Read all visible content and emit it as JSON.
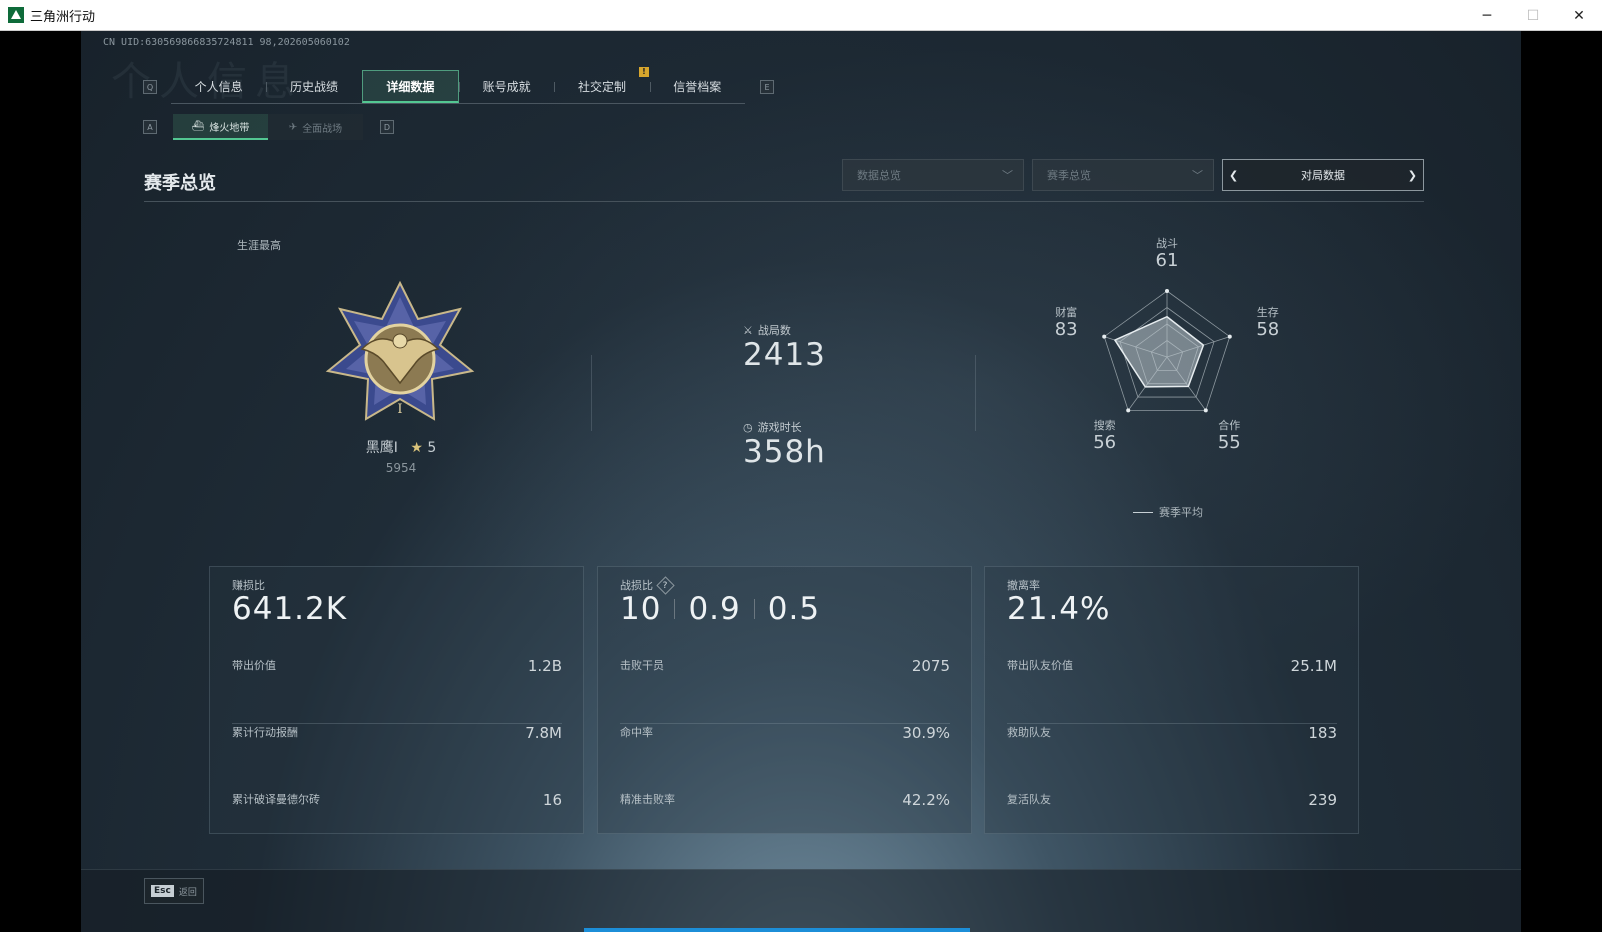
{
  "window": {
    "title": "三角洲行动",
    "minimize": "─",
    "maximize": "☐",
    "close": "✕"
  },
  "uid": "CN UID:630569866835724811 98,202605060102",
  "header": {
    "tabs": [
      {
        "label": "个人信息"
      },
      {
        "label": "历史战绩"
      },
      {
        "label": "详细数据"
      },
      {
        "label": "账号成就"
      },
      {
        "label": "社交定制"
      },
      {
        "label": "信誉档案"
      }
    ],
    "active_tab": "详细数据",
    "key_left": "Q",
    "key_right": "E",
    "notice_mark": "!"
  },
  "subtabs": {
    "key_left": "A",
    "key_right": "D",
    "items": [
      {
        "label": "烽火地带"
      },
      {
        "label": "全面战场"
      }
    ]
  },
  "section": {
    "title": "赛季总览",
    "filter1": "数据总览",
    "filter2": "赛季总览",
    "pager_label": "对局数据"
  },
  "career": {
    "label": "生涯最高",
    "rank_name": "黑鹰I",
    "stars": "5",
    "score": "5954"
  },
  "stats": {
    "matches_label": "战局数",
    "matches_value": "2413",
    "playtime_label": "游戏时长",
    "playtime_value": "358h"
  },
  "radar": {
    "axes": [
      {
        "label": "战斗",
        "value": 61
      },
      {
        "label": "生存",
        "value": 58
      },
      {
        "label": "合作",
        "value": 55
      },
      {
        "label": "搜索",
        "value": 56
      },
      {
        "label": "财富",
        "value": 83
      }
    ],
    "legend": "赛季平均"
  },
  "cards": [
    {
      "title": "赚损比",
      "big": "641.2K",
      "rows": [
        {
          "label": "带出价值",
          "value": "1.2B"
        },
        {
          "label": "累计行动报酬",
          "value": "7.8M"
        },
        {
          "label": "累计破译曼德尔砖",
          "value": "16"
        }
      ]
    },
    {
      "title": "战损比",
      "big_parts": [
        "10",
        "0.9",
        "0.5"
      ],
      "help": "?",
      "rows": [
        {
          "label": "击败干员",
          "value": "2075"
        },
        {
          "label": "命中率",
          "value": "30.9%"
        },
        {
          "label": "精准击败率",
          "value": "42.2%"
        }
      ]
    },
    {
      "title": "撤离率",
      "big": "21.4%",
      "rows": [
        {
          "label": "带出队友价值",
          "value": "25.1M"
        },
        {
          "label": "救助队友",
          "value": "183"
        },
        {
          "label": "复活队友",
          "value": "239"
        }
      ]
    }
  ],
  "footer": {
    "esc_key": "Esc",
    "esc_label": "返回"
  },
  "colors": {
    "accent": "#53c792",
    "progress": "#1c8ed8",
    "notice": "#d7a62d"
  }
}
